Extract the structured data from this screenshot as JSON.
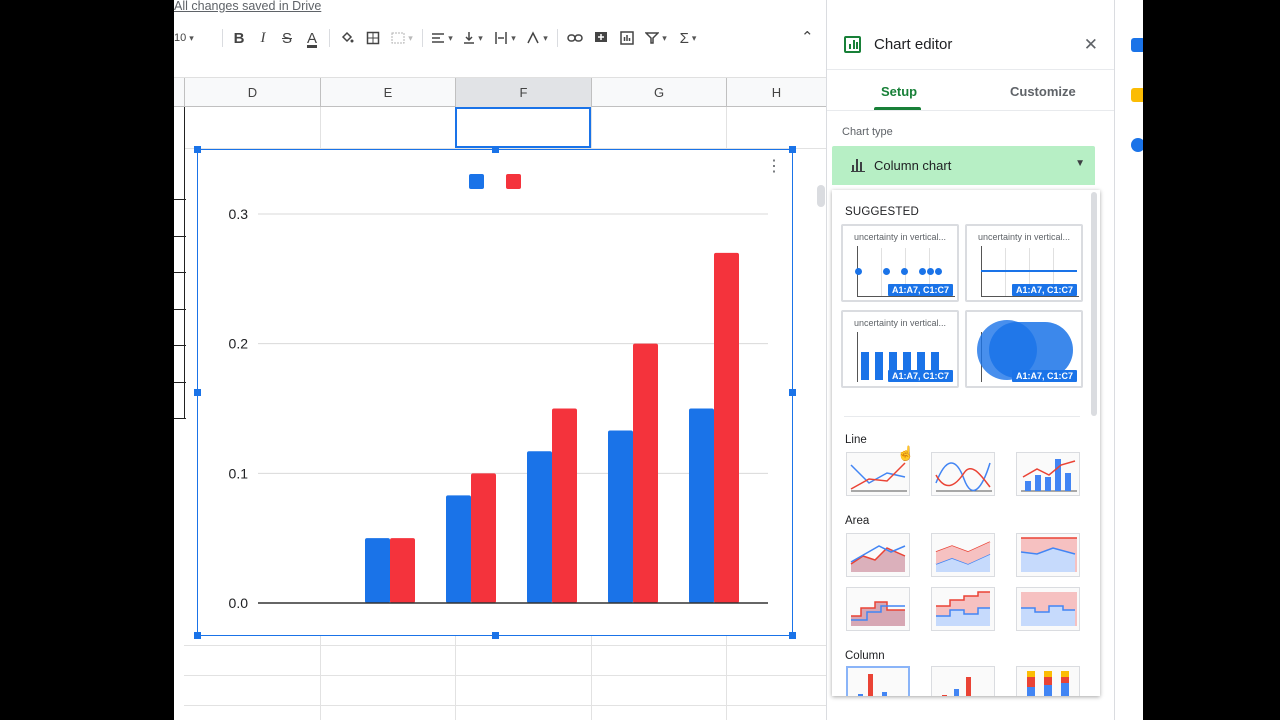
{
  "header": {
    "save_status": "All changes saved in Drive",
    "font_size": "10"
  },
  "toolbar": {
    "buttons": [
      "bold-icon",
      "italic-icon",
      "strikethrough-icon",
      "text-color-icon",
      "fill-color-icon",
      "borders-icon",
      "merge-cells-icon",
      "align-horizontal-icon",
      "align-vertical-icon",
      "text-wrap-icon",
      "text-rotate-icon",
      "link-icon",
      "comment-icon",
      "insert-chart-icon",
      "filter-icon",
      "functions-icon"
    ],
    "bold": "B",
    "italic": "I",
    "strike": "S",
    "text_color": "A",
    "functions": "Σ",
    "collapse": "⌃"
  },
  "grid": {
    "columns": [
      "D",
      "E",
      "F",
      "G",
      "H"
    ],
    "selected_column": "F"
  },
  "chart": {
    "legend": [
      {
        "color": "#1a73e8"
      },
      {
        "color": "#f4333c"
      }
    ]
  },
  "chart_data": {
    "type": "bar",
    "title": "",
    "xlabel": "",
    "ylabel": "",
    "ylim": [
      0,
      0.3
    ],
    "y_ticks": [
      "0.0",
      "0.1",
      "0.2",
      "0.3"
    ],
    "grid": true,
    "legend_position": "top",
    "series": [
      {
        "values": [
          0.05,
          0.083,
          0.117,
          0.133,
          0.15
        ],
        "color": "#1a73e8"
      },
      {
        "values": [
          0.05,
          0.1,
          0.15,
          0.2,
          0.27
        ],
        "color": "#f4333c"
      }
    ]
  },
  "panel": {
    "title": "Chart editor",
    "close": "✕",
    "tabs": {
      "setup": "Setup",
      "customize": "Customize"
    },
    "chart_type_label": "Chart type",
    "chart_type_value": "Column chart",
    "sections": {
      "suggested": "SUGGESTED",
      "line": "Line",
      "area": "Area",
      "column": "Column"
    },
    "suggested_cards": [
      {
        "title": "uncertainty in vertical...",
        "tag": "A1:A7, C1:C7"
      },
      {
        "title": "uncertainty in vertical...",
        "tag": "A1:A7, C1:C7"
      },
      {
        "title": "uncertainty in vertical...",
        "tag": "A1:A7, C1:C7"
      },
      {
        "title": "",
        "tag": "A1:A7, C1:C7"
      }
    ]
  },
  "colors": {
    "accent_green": "#188038",
    "select_green": "#b7efc5",
    "blue": "#1a73e8",
    "red": "#f4333c"
  }
}
